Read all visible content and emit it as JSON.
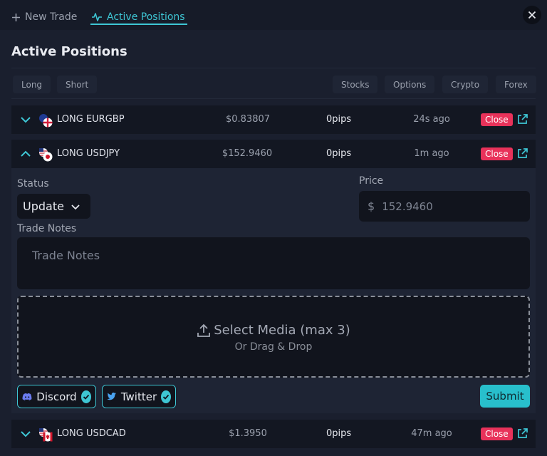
{
  "tabs": {
    "new_trade": "New Trade",
    "active_positions": "Active Positions"
  },
  "page_title": "Active Positions",
  "filters": {
    "left": [
      "Long",
      "Short"
    ],
    "right": [
      "Stocks",
      "Options",
      "Crypto",
      "Forex"
    ]
  },
  "positions": [
    {
      "symbol": "LONG EURGBP",
      "price": "$0.83807",
      "pips": "0pips",
      "ago": "24s ago",
      "close_label": "Close",
      "expanded": false
    },
    {
      "symbol": "LONG USDJPY",
      "price": "$152.9460",
      "pips": "0pips",
      "ago": "1m ago",
      "close_label": "Close",
      "expanded": true
    },
    {
      "symbol": "LONG USDCAD",
      "price": "$1.3950",
      "pips": "0pips",
      "ago": "47m ago",
      "close_label": "Close",
      "expanded": false
    }
  ],
  "form": {
    "status_label": "Status",
    "status_value": "Update",
    "price_label": "Price",
    "price_placeholder": "152.9460",
    "currency_symbol": "$",
    "notes_label": "Trade Notes",
    "notes_placeholder": "Trade Notes",
    "dropzone_title": "Select Media (max 3)",
    "dropzone_subtitle": "Or Drag & Drop",
    "discord_label": "Discord",
    "twitter_label": "Twitter",
    "submit_label": "Submit"
  },
  "colors": {
    "accent": "#3ec6d4",
    "close_button": "#e8325a",
    "background": "#1a1f2e",
    "row_background": "#131722"
  },
  "icons": {
    "plus": "plus-icon",
    "pulse": "activity-icon",
    "close": "close-icon",
    "chevron_down": "chevron-down-icon",
    "chevron_up": "chevron-up-icon",
    "external": "external-link-icon",
    "upload": "upload-icon",
    "discord": "discord-icon",
    "twitter": "twitter-icon",
    "check": "check-icon"
  }
}
